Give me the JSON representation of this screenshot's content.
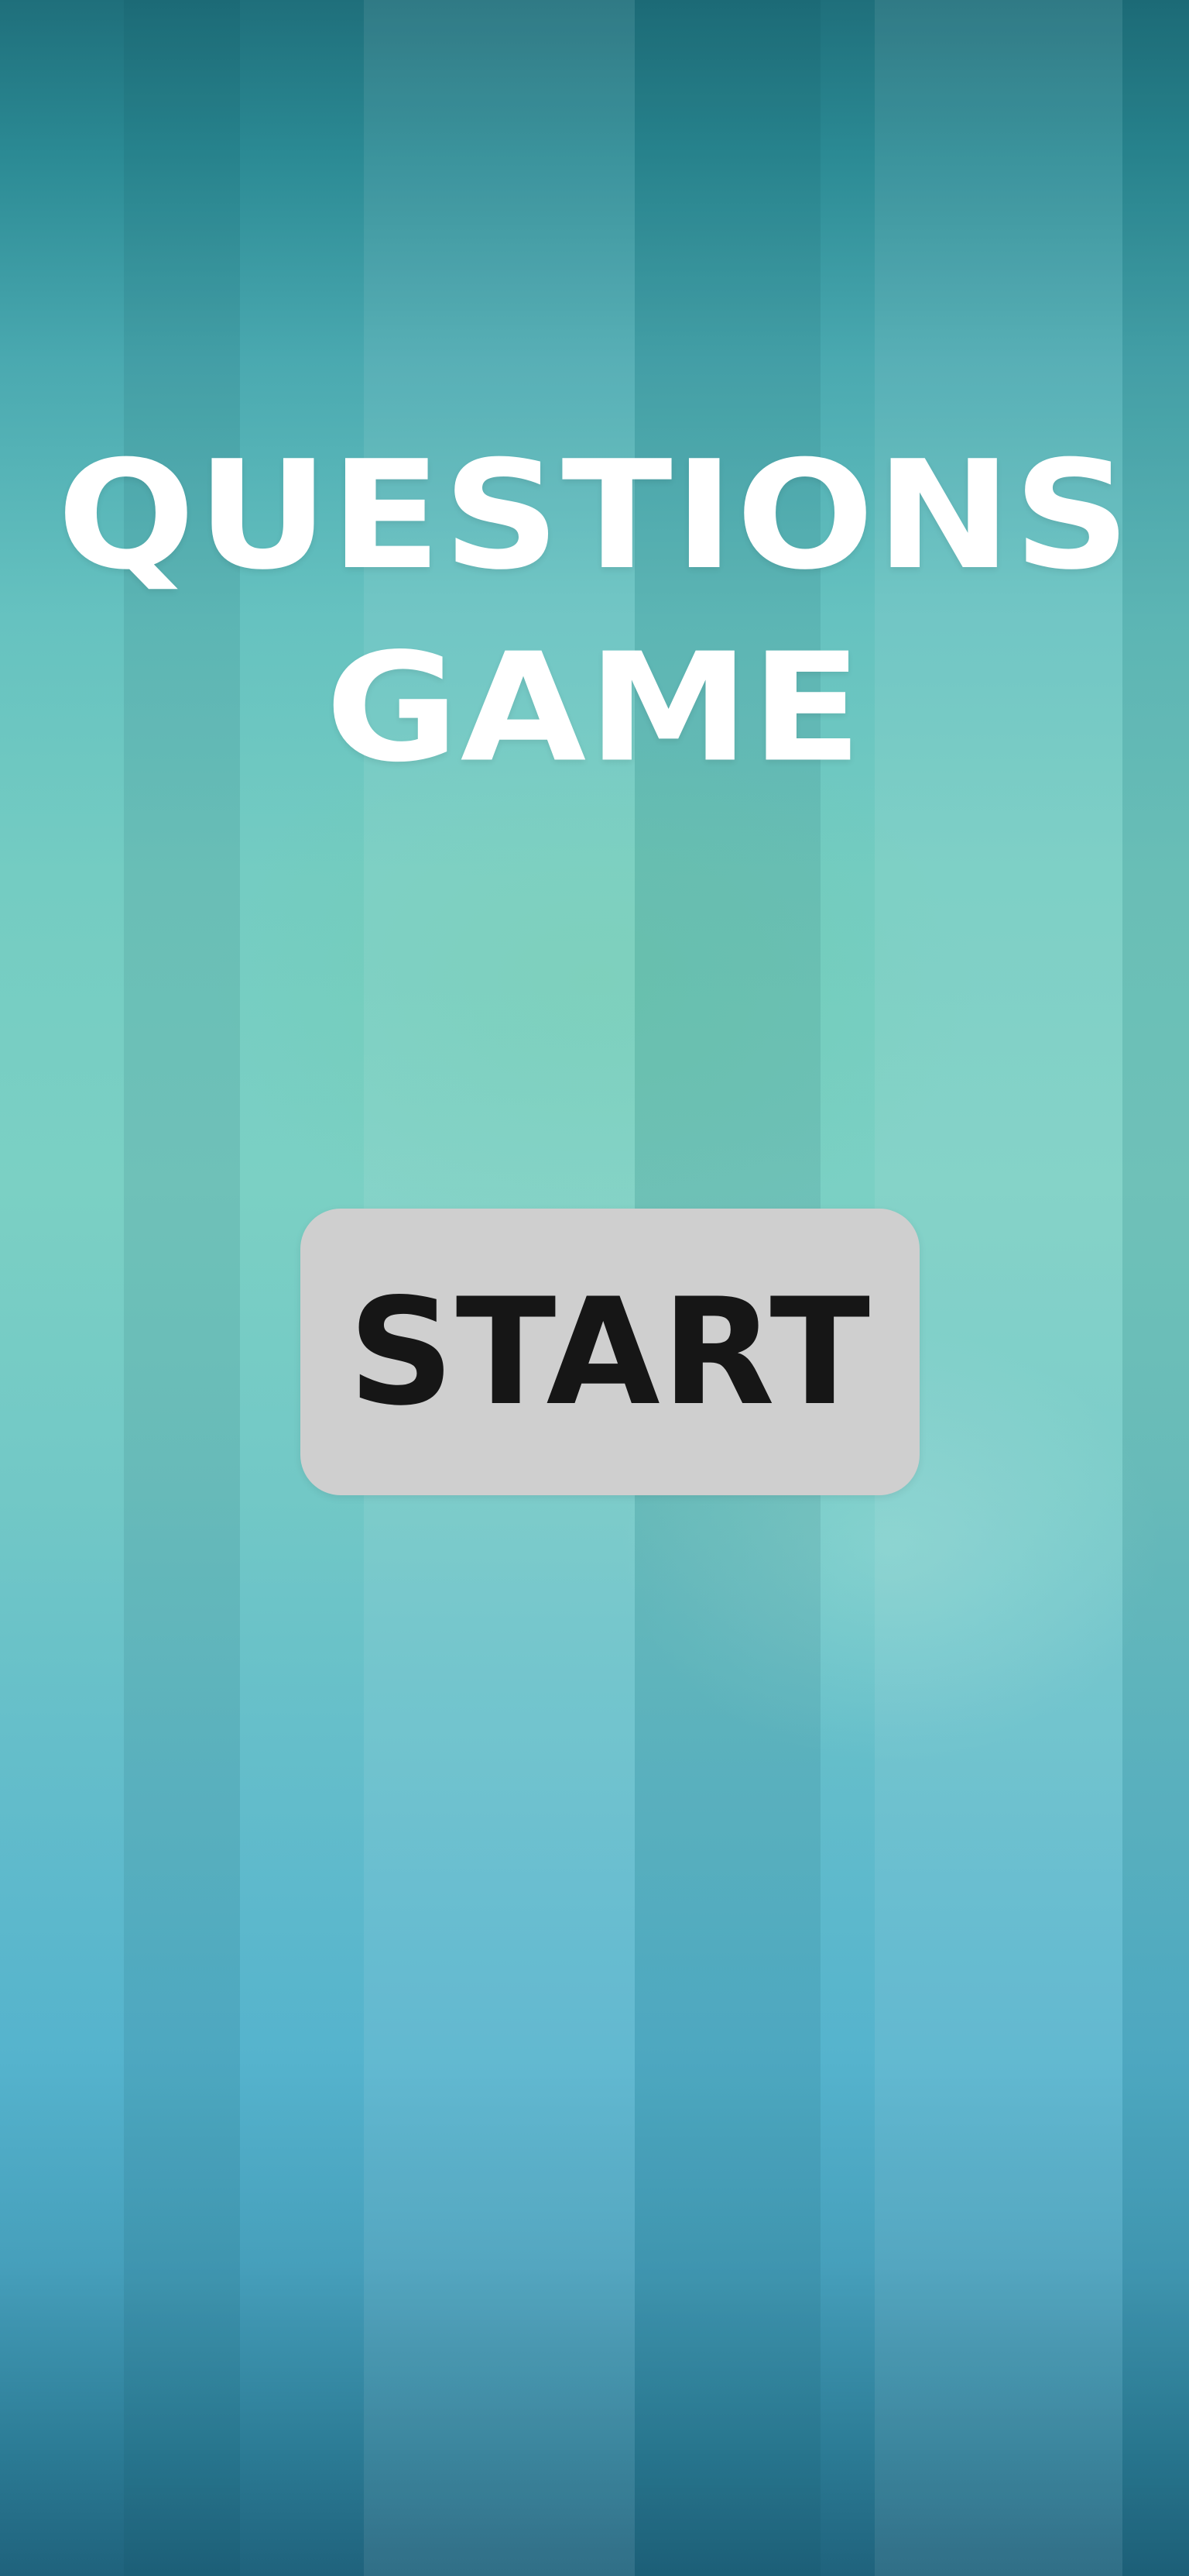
{
  "game": {
    "title_line_1": "QUESTIONS",
    "title_line_2": "GAME",
    "start_button_label": "START"
  },
  "colors": {
    "background_top": "#1f6f7b",
    "background_mid": "#7bd0c4",
    "background_bottom": "#1f627c",
    "title_text": "#ffffff",
    "button_background": "#cfcfcf",
    "button_text": "#161616"
  }
}
